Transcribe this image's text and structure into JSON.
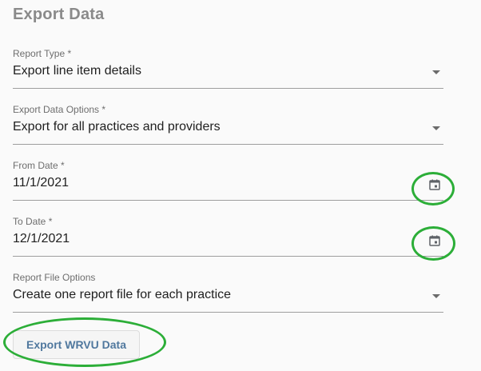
{
  "page": {
    "title": "Export Data"
  },
  "fields": {
    "report_type": {
      "label": "Report Type *",
      "value": "Export line item details",
      "icon": "dropdown-caret"
    },
    "export_data_options": {
      "label": "Export Data Options *",
      "value": "Export for all practices and providers",
      "icon": "dropdown-caret"
    },
    "from_date": {
      "label": "From Date *",
      "value": "11/1/2021",
      "icon": "calendar-icon"
    },
    "to_date": {
      "label": "To Date *",
      "value": "12/1/2021",
      "icon": "calendar-icon"
    },
    "report_file_options": {
      "label": "Report File Options",
      "value": "Create one report file for each practice",
      "icon": "dropdown-caret"
    }
  },
  "actions": {
    "export_button": "Export WRVU Data"
  },
  "colors": {
    "title": "#8a8a8a",
    "label": "#6e6e6e",
    "underline": "#9e9e9e",
    "button_text": "#50789e",
    "annotation_circle": "#2cae38"
  }
}
